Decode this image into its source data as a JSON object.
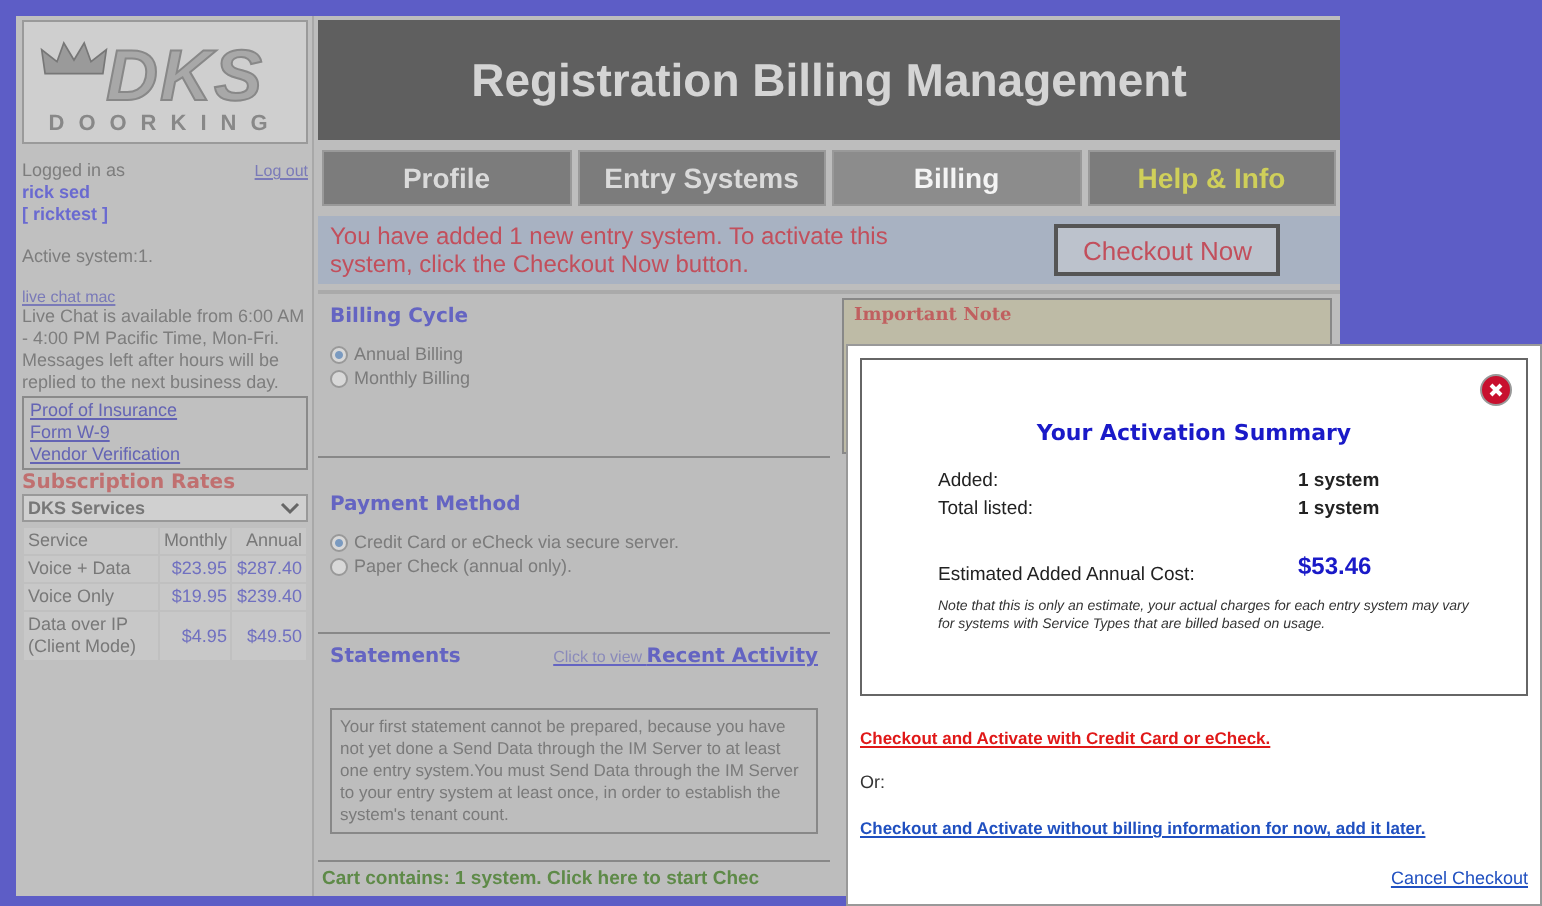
{
  "logo": {
    "mark": "DKS",
    "name": "DOORKING"
  },
  "header": {
    "title": "Registration Billing Management"
  },
  "sidebar": {
    "logged_in_label": "Logged in as",
    "logout": "Log out",
    "user_name": "rick sed",
    "user_login": "[ ricktest ]",
    "active_system": "Active system:1.",
    "chat_link": "live chat mac",
    "chat_note": "Live Chat is available from 6:00 AM - 4:00 PM Pacific Time, Mon-Fri. Messages left after hours will be replied to the next business day.",
    "documents": [
      "Proof of Insurance",
      "Form W-9",
      "Vendor Verification"
    ],
    "rates_title": "Subscription Rates",
    "rates_select": "DKS Services",
    "rates_table": {
      "columns": [
        "Service",
        "Monthly",
        "Annual"
      ],
      "rows": [
        [
          "Voice + Data",
          "$23.95",
          "$287.40"
        ],
        [
          "Voice Only",
          "$19.95",
          "$239.40"
        ],
        [
          "Data over IP (Client Mode)",
          "$4.95",
          "$49.50"
        ]
      ]
    }
  },
  "tabs": [
    {
      "label": "Profile",
      "kind": "normal",
      "selected": false
    },
    {
      "label": "Entry Systems",
      "kind": "normal",
      "selected": false
    },
    {
      "label": "Billing",
      "kind": "normal",
      "selected": true
    },
    {
      "label": "Help & Info",
      "kind": "help",
      "selected": false
    }
  ],
  "notice": {
    "message": "You have added 1 new entry system. To activate this system, click the Checkout Now button.",
    "button": "Checkout Now"
  },
  "billing_cycle": {
    "title": "Billing Cycle",
    "options": [
      {
        "label": "Annual Billing",
        "selected": true
      },
      {
        "label": "Monthly Billing",
        "selected": false
      }
    ]
  },
  "important_note": {
    "title": "Important Note"
  },
  "payment_method": {
    "title": "Payment Method",
    "options": [
      {
        "label": "Credit Card or eCheck via secure server.",
        "selected": true
      },
      {
        "label": "Paper Check (annual only).",
        "selected": false
      }
    ]
  },
  "statements": {
    "title": "Statements",
    "link_prefix": "Click to view",
    "link": "Recent Activity",
    "message": "Your first statement cannot be prepared, because you have not yet done a Send Data through the IM Server to at least one entry system.You must Send Data through the IM Server to your entry system at least once, in order to establish the system's tenant count."
  },
  "cart": "Cart contains: 1 system. Click here to start Chec",
  "modal": {
    "title": "Your Activation Summary",
    "rows": [
      {
        "label": "Added:",
        "value": "1 system"
      },
      {
        "label": "Total listed:",
        "value": "1 system"
      }
    ],
    "cost_label": "Estimated Added Annual Cost:",
    "cost_value": "$53.46",
    "note": "Note that this is only an estimate, your actual charges for each entry system may vary for systems with Service Types that are billed based on usage.",
    "pay_link": "Checkout and Activate with Credit Card or eCheck.",
    "or": "Or:",
    "later_link": "Checkout and Activate without billing information for now, add it later.",
    "cancel": "Cancel Checkout"
  }
}
